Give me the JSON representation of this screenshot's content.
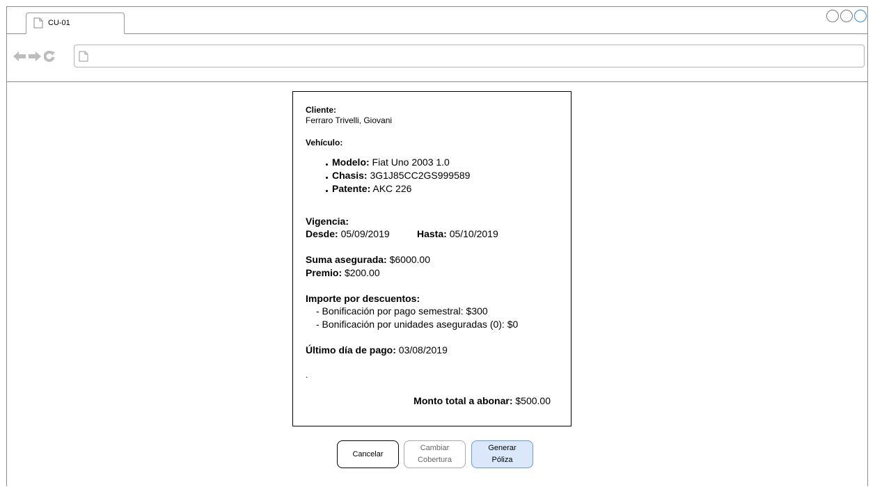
{
  "browser": {
    "tab_title": "CU-01",
    "url": ""
  },
  "policy": {
    "cliente_label": "Cliente:",
    "cliente_value": "Ferraro Trivelli, Giovani",
    "vehiculo_label": "Vehículo:",
    "vehiculo_items": [
      {
        "label": "Modelo:",
        "value": "Fiat Uno 2003 1.0"
      },
      {
        "label": "Chasis:",
        "value": "3G1J85CC2GS999589"
      },
      {
        "label": "Patente:",
        "value": "AKC 226"
      }
    ],
    "vigencia_label": "Vigencia:",
    "desde_label": "Desde:",
    "desde_value": "05/09/2019",
    "hasta_label": "Hasta:",
    "hasta_value": "05/10/2019",
    "suma_label": "Suma asegurada:",
    "suma_value": "$6000.00",
    "premio_label": "Premio:",
    "premio_value": "$200.00",
    "importe_label": "Importe por descuentos:",
    "descuentos": [
      "- Bonificación por pago semestral: $300",
      "- Bonificación por unidades aseguradas (0): $0"
    ],
    "ultimo_label": "Último día de pago:",
    "ultimo_value": "03/08/2019",
    "dot": ".",
    "monto_label": "Monto total a abonar:",
    "monto_value": "$500.00"
  },
  "actions": {
    "cancel_label": "Cancelar",
    "cambiar_line1": "Cambiar",
    "cambiar_line2": "Cobertura",
    "generar_line1": "Generar",
    "generar_line2": "Póliza"
  },
  "colors": {
    "primary_button_bg": "#dbe8fb",
    "primary_button_border": "#6c9ad8",
    "disabled_text": "#666666"
  }
}
